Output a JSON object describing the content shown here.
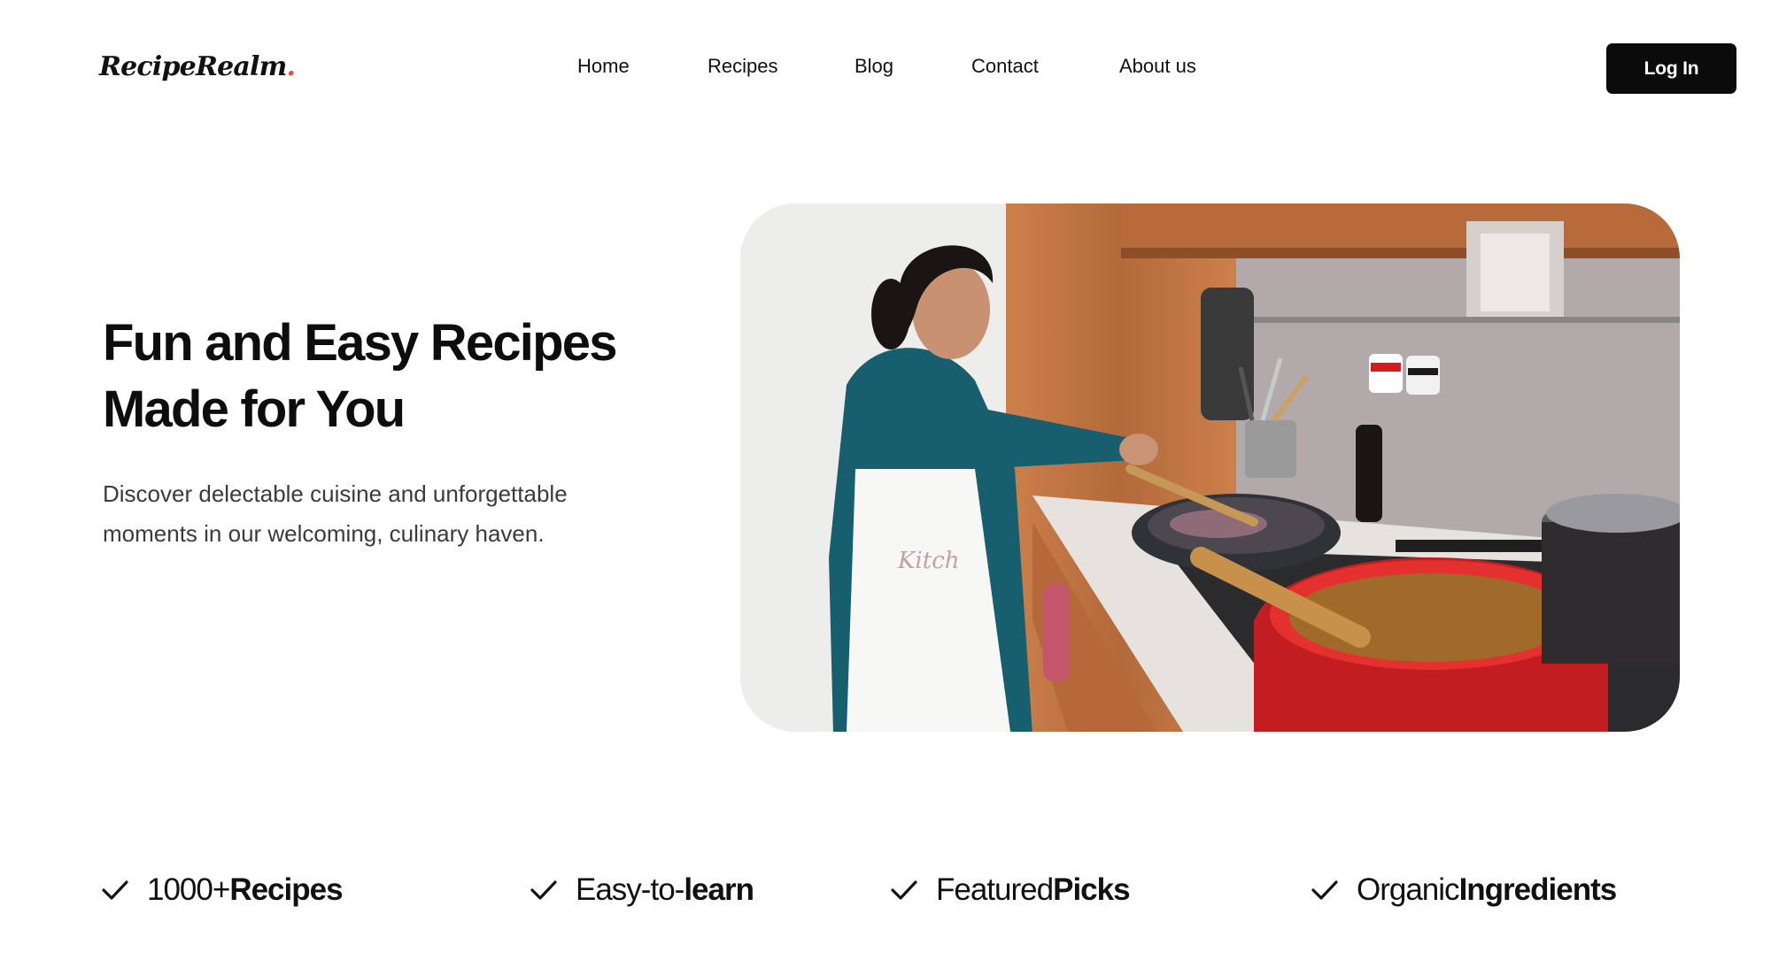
{
  "brand": {
    "name": "RecipeRealm",
    "dot": "."
  },
  "nav": {
    "items": [
      {
        "label": "Home"
      },
      {
        "label": "Recipes"
      },
      {
        "label": "Blog"
      },
      {
        "label": "Contact"
      },
      {
        "label": "About us"
      }
    ]
  },
  "header": {
    "login_label": "Log In"
  },
  "hero": {
    "title_line1": "Fun and Easy Recipes",
    "title_line2": "Made for You",
    "desc_line1": "Discover delectable cuisine and unforgettable",
    "desc_line2": "moments in our welcoming, culinary haven.",
    "image_alt": "A woman in a white apron stirring food in a pan on a kitchen stove next to a red pot"
  },
  "features": [
    {
      "prefix": "1000+ ",
      "strong": "Recipes",
      "icon": "check-icon"
    },
    {
      "prefix": "Easy-to-",
      "strong": "learn",
      "icon": "check-icon"
    },
    {
      "prefix": "Featured ",
      "strong": "Picks",
      "icon": "check-icon"
    },
    {
      "prefix": "Organic ",
      "strong": "Ingredients",
      "icon": "check-icon"
    }
  ],
  "colors": {
    "accent": "#e2552b",
    "button_bg": "#0b0b0b",
    "button_text": "#ffffff",
    "text_primary": "#111111",
    "text_secondary": "#3b3b3b",
    "background": "#ffffff"
  }
}
